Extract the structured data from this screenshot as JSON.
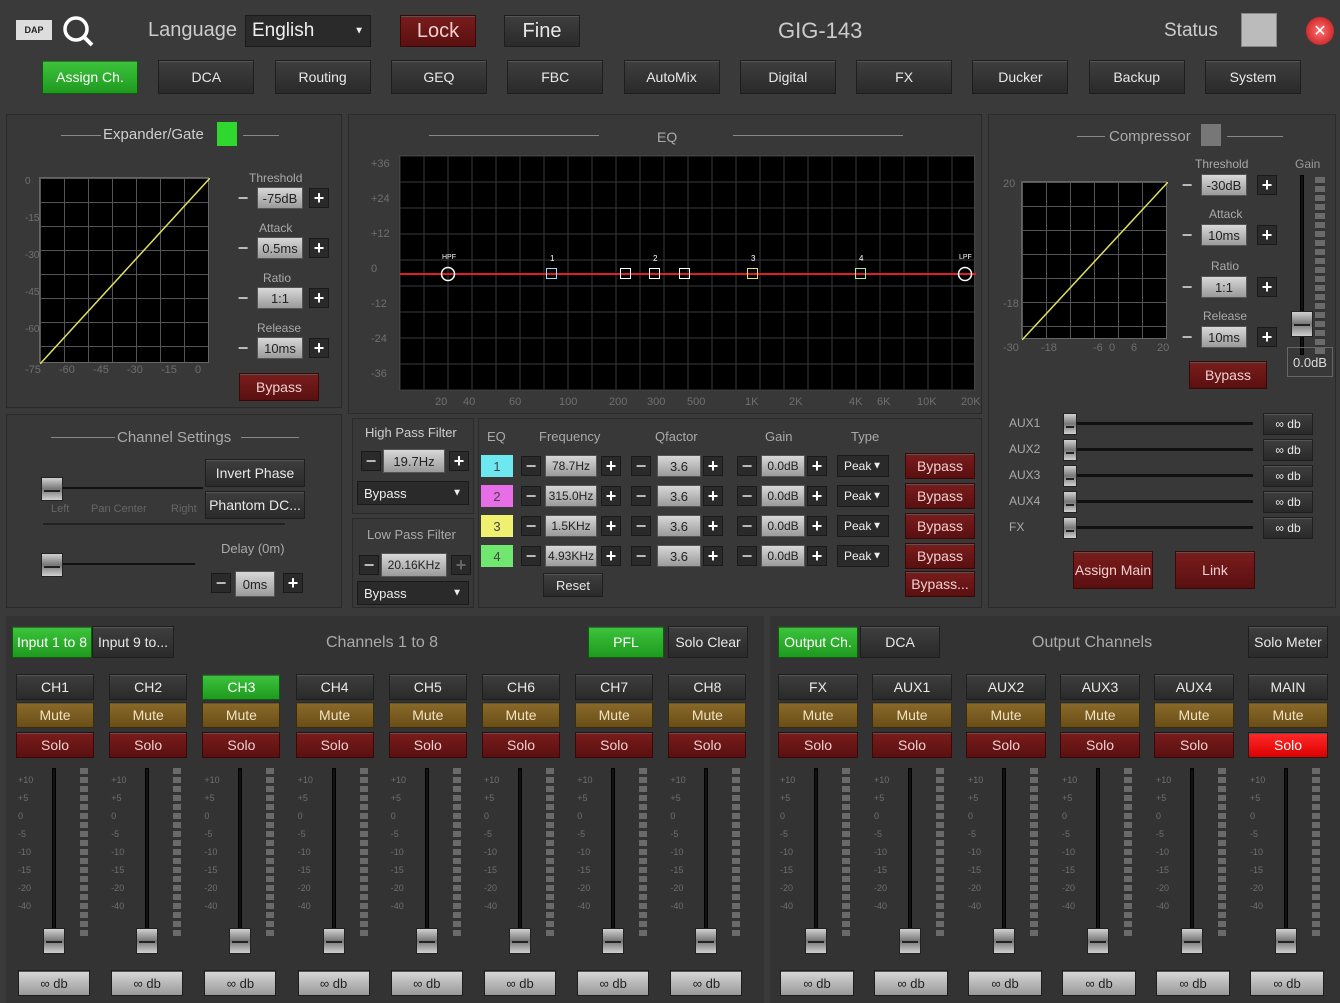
{
  "header": {
    "language_label": "Language",
    "language": "English",
    "lock": "Lock",
    "fine": "Fine",
    "title": "GIG-143",
    "status_label": "Status"
  },
  "tabs": [
    "Assign Ch.",
    "DCA",
    "Routing",
    "GEQ",
    "FBC",
    "AutoMix",
    "Digital",
    "FX",
    "Ducker",
    "Backup",
    "System"
  ],
  "expander": {
    "title": "Expander/Gate",
    "threshold_label": "Threshold",
    "threshold": "-75dB",
    "attack_label": "Attack",
    "attack": "0.5ms",
    "ratio_label": "Ratio",
    "ratio": "1:1",
    "release_label": "Release",
    "release": "10ms",
    "bypass": "Bypass",
    "x_ticks": [
      "-75",
      "-60",
      "-45",
      "-30",
      "-15",
      "0"
    ],
    "y_ticks": [
      "0",
      "-15",
      "-30",
      "-45",
      "-60"
    ]
  },
  "eq": {
    "title": "EQ",
    "y_ticks": [
      "+36",
      "+24",
      "+12",
      "0",
      "-12",
      "-24",
      "-36"
    ],
    "x_ticks": [
      "20",
      "40",
      "60",
      "100",
      "200",
      "300",
      "500",
      "1K",
      "2K",
      "4K",
      "6K",
      "10K",
      "20K"
    ],
    "hpf": "HPF",
    "lpf": "LPF",
    "band_nums": [
      "1",
      "2",
      "3",
      "4"
    ]
  },
  "filters": {
    "hpf_label": "High Pass Filter",
    "hpf_val": "19.7Hz",
    "hpf_mode": "Bypass",
    "lpf_label": "Low Pass Filter",
    "lpf_val": "20.16KHz",
    "lpf_mode": "Bypass"
  },
  "eq_table": {
    "headers": [
      "EQ",
      "Frequency",
      "Qfactor",
      "Gain",
      "Type"
    ],
    "rows": [
      {
        "n": "1",
        "freq": "78.7Hz",
        "q": "3.6",
        "gain": "0.0dB",
        "type": "Peak",
        "bypass": "Bypass",
        "color": "#6ee8f0"
      },
      {
        "n": "2",
        "freq": "315.0Hz",
        "q": "3.6",
        "gain": "0.0dB",
        "type": "Peak",
        "bypass": "Bypass",
        "color": "#e86ee8"
      },
      {
        "n": "3",
        "freq": "1.5KHz",
        "q": "3.6",
        "gain": "0.0dB",
        "type": "Peak",
        "bypass": "Bypass",
        "color": "#f0f070"
      },
      {
        "n": "4",
        "freq": "4.93KHz",
        "q": "3.6",
        "gain": "0.0dB",
        "type": "Peak",
        "bypass": "Bypass",
        "color": "#70e870"
      }
    ],
    "reset": "Reset",
    "bypass_all": "Bypass..."
  },
  "compressor": {
    "title": "Compressor",
    "threshold_label": "Threshold",
    "threshold": "-30dB",
    "attack_label": "Attack",
    "attack": "10ms",
    "ratio_label": "Ratio",
    "ratio": "1:1",
    "release_label": "Release",
    "release": "10ms",
    "bypass": "Bypass",
    "gain_label": "Gain",
    "gain": "0.0dB",
    "x_ticks": [
      "-30",
      "-18",
      "-6",
      "0",
      "6",
      "20"
    ],
    "y_ticks": [
      "20",
      "-18"
    ]
  },
  "aux": {
    "rows": [
      {
        "label": "AUX1",
        "val": "∞ db"
      },
      {
        "label": "AUX2",
        "val": "∞ db"
      },
      {
        "label": "AUX3",
        "val": "∞ db"
      },
      {
        "label": "AUX4",
        "val": "∞ db"
      },
      {
        "label": "FX",
        "val": "∞ db"
      }
    ],
    "assign_main": "Assign Main",
    "link": "Link"
  },
  "channel_settings": {
    "title": "Channel Settings",
    "invert": "Invert Phase",
    "phantom": "Phantom DC...",
    "left": "Left",
    "center": "Pan Center",
    "right": "Right",
    "delay_label": "Delay (0m)",
    "delay": "0ms"
  },
  "inputs": {
    "tab1": "Input 1 to 8",
    "tab2": "Input 9 to...",
    "title": "Channels 1 to 8",
    "pfl": "PFL",
    "solo_clear": "Solo Clear",
    "channels": [
      "CH1",
      "CH2",
      "CH3",
      "CH4",
      "CH5",
      "CH6",
      "CH7",
      "CH8"
    ],
    "mute": "Mute",
    "solo": "Solo",
    "db": "∞ db",
    "scale": [
      "+10",
      "+5",
      "0",
      "-5",
      "-10",
      "-15",
      "-20",
      "-40"
    ]
  },
  "outputs": {
    "tab1": "Output Ch.",
    "tab2": "DCA",
    "title": "Output Channels",
    "solo_meter": "Solo Meter",
    "channels": [
      "FX",
      "AUX1",
      "AUX2",
      "AUX3",
      "AUX4",
      "MAIN"
    ],
    "mute": "Mute",
    "solo": "Solo",
    "db": "∞ db"
  },
  "colors": {
    "green": "#2db52d",
    "red_btn": "#6a1414",
    "mute": "#7a5c20",
    "eq_line": "#e02020",
    "solo_active": "#ff2020"
  }
}
